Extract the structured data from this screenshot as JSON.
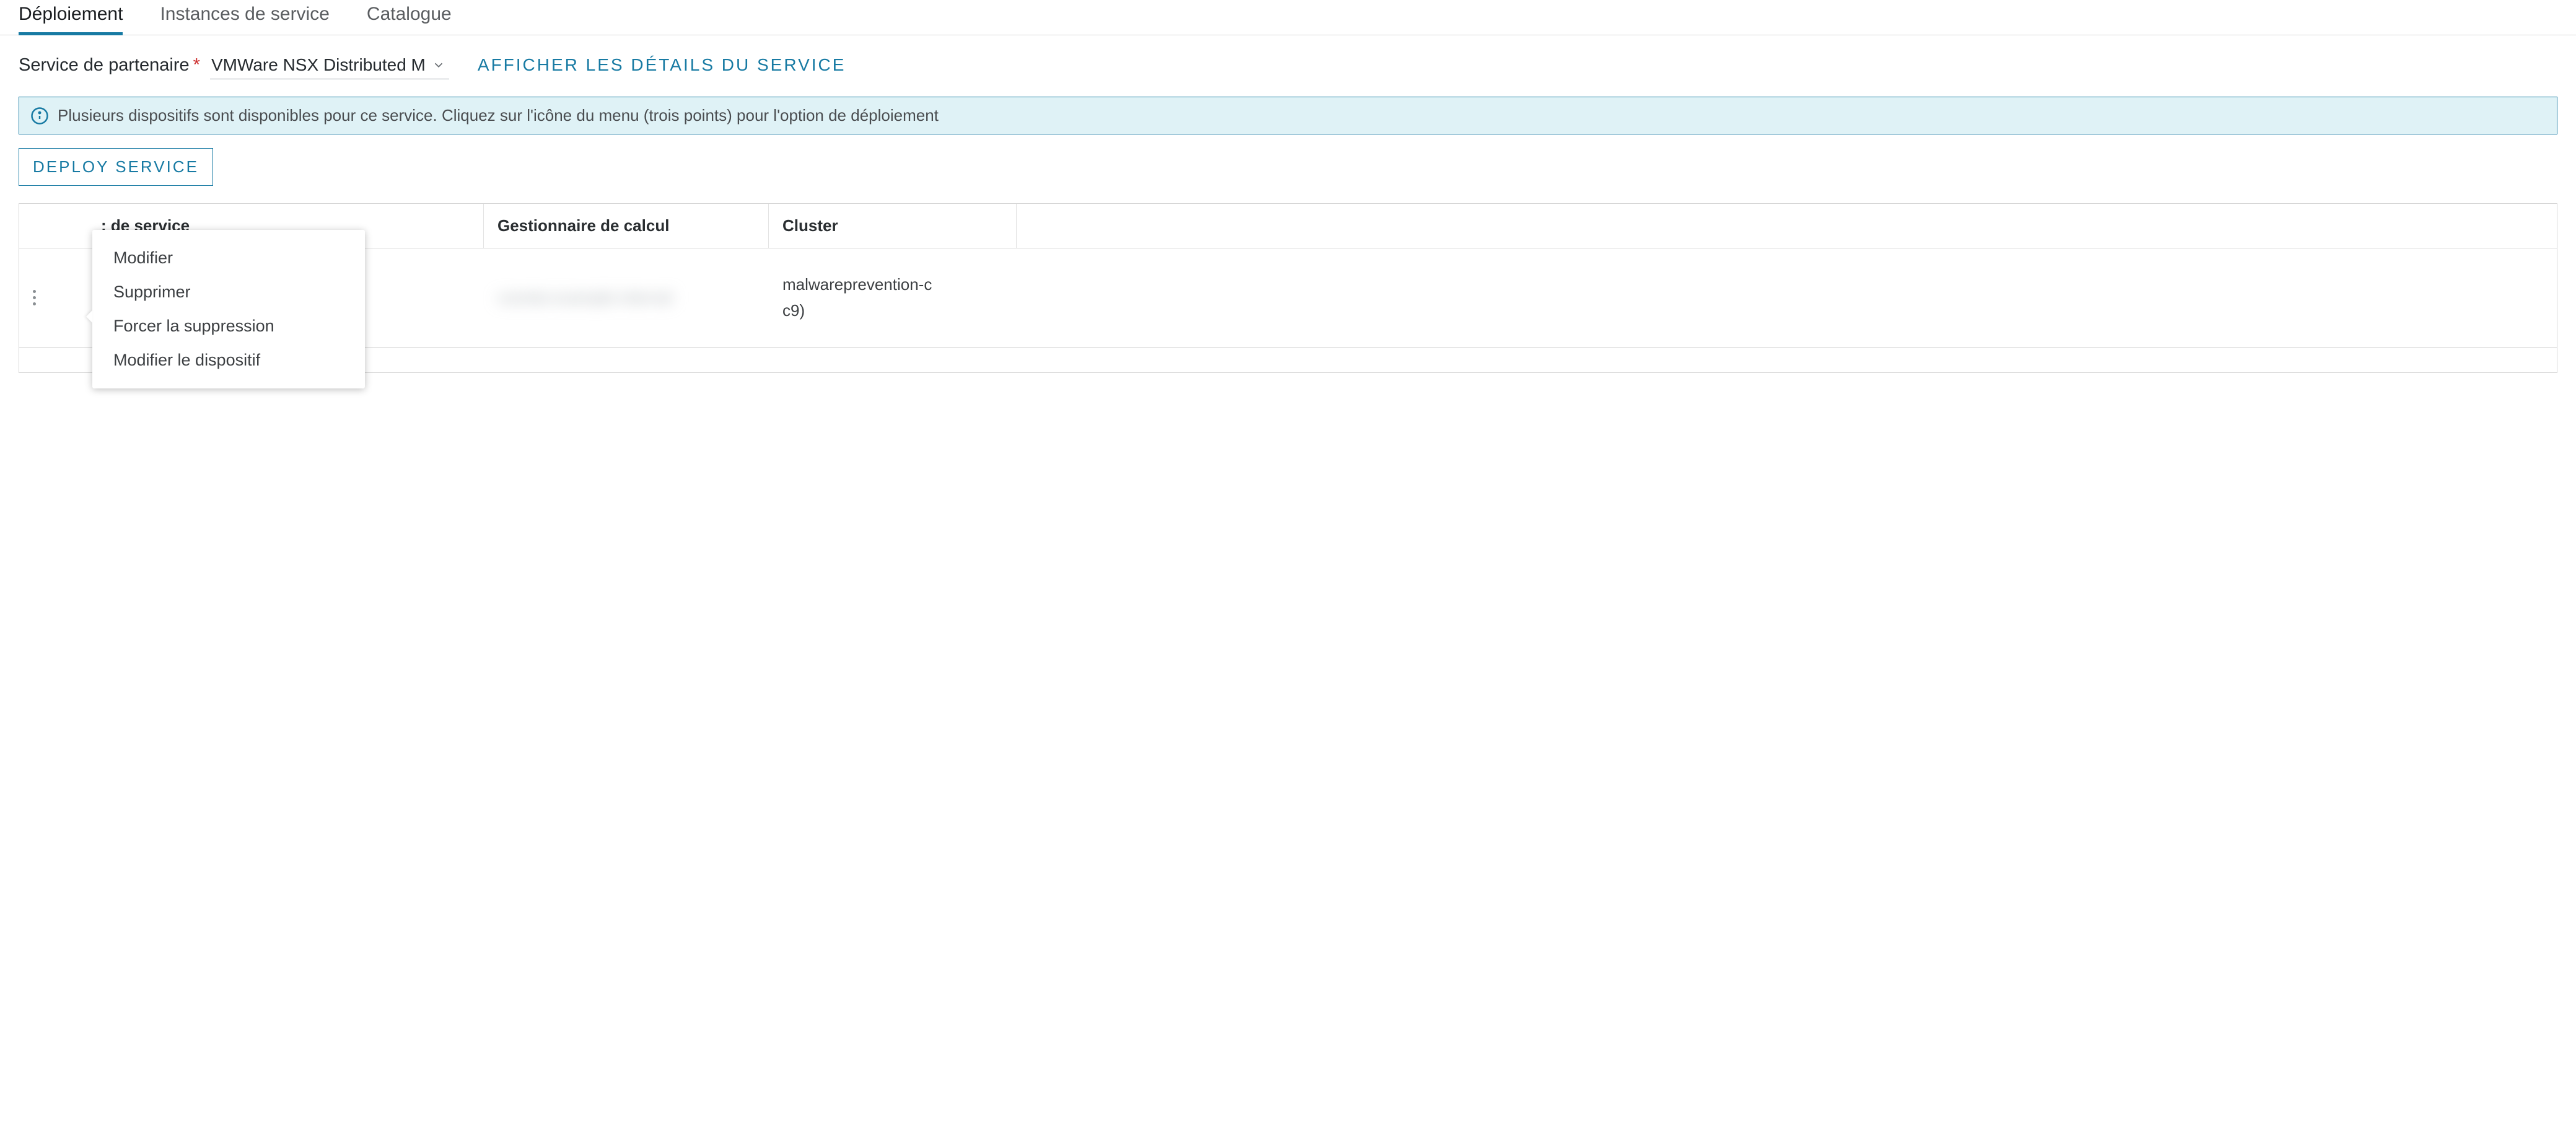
{
  "tabs": {
    "deployment": "Déploiement",
    "service_instances": "Instances de service",
    "catalogue": "Catalogue"
  },
  "partner": {
    "label": "Service de partenaire",
    "selected": "VMWare NSX Distributed M",
    "details_link": "AFFICHER LES DÉTAILS DU SERVICE"
  },
  "banner": {
    "text": "Plusieurs dispositifs sont disponibles pour ce service. Cliquez sur l'icône du menu (trois points) pour l'option de déploiement"
  },
  "deploy_button": "DEPLOY SERVICE",
  "columns": {
    "c1": ": de service",
    "c2": "Gestionnaire de calcul",
    "c3": "Cluster"
  },
  "row": {
    "compute_manager": "",
    "cluster_line1": "malwareprevention-c",
    "cluster_line2": "c9)"
  },
  "menu": {
    "edit": "Modifier",
    "delete": "Supprimer",
    "force_delete": "Forcer la suppression",
    "change_appliance": "Modifier le dispositif"
  }
}
